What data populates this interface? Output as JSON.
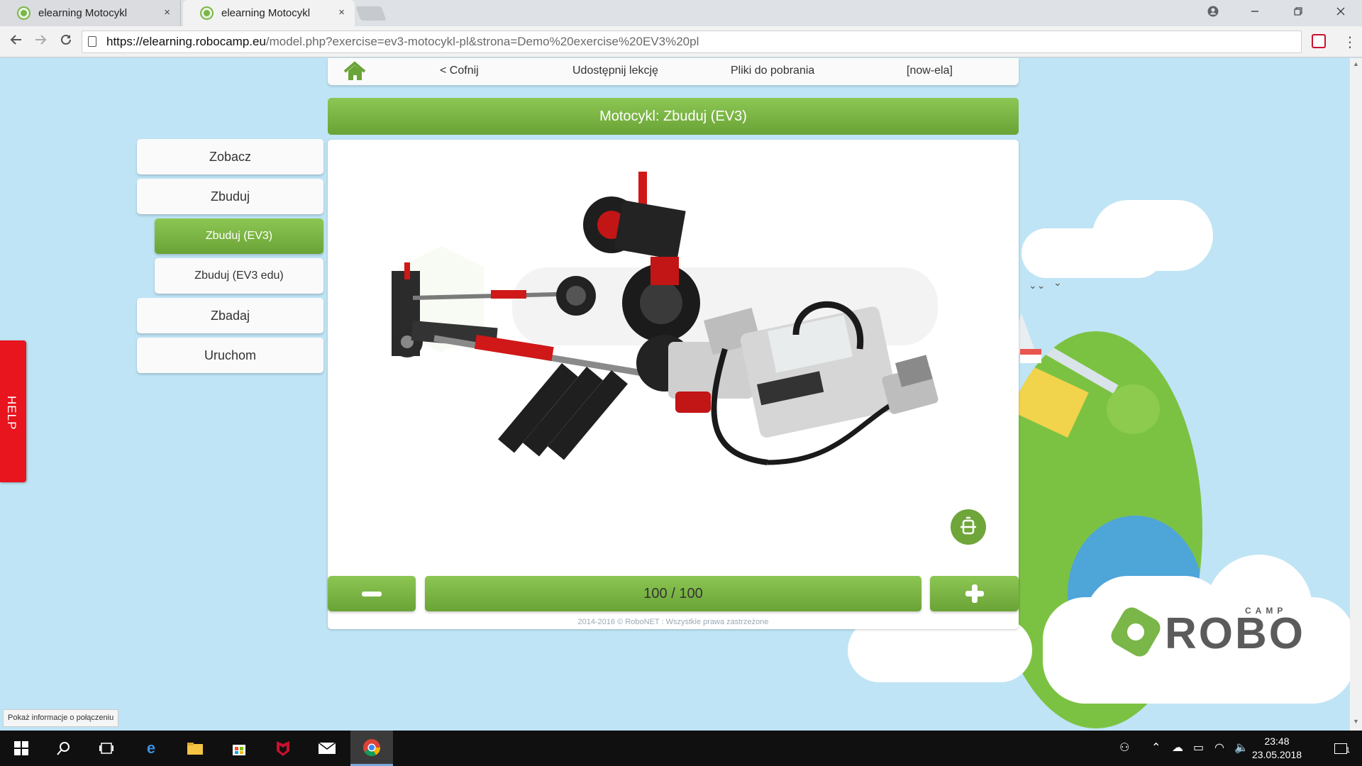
{
  "browser": {
    "tabs": [
      {
        "title": "elearning Motocykl",
        "close": "×"
      },
      {
        "title": "elearning Motocykl",
        "close": "×"
      }
    ],
    "url_host": "https://elearning.robocamp.eu",
    "url_rest": "/model.php?exercise=ev3-motocykl-pl&strona=Demo%20exercise%20EV3%20pl"
  },
  "nav": {
    "back": "< Cofnij",
    "share": "Udostępnij lekcję",
    "downloads": "Pliki do pobrania",
    "user": "[now-ela]"
  },
  "page_title": "Motocykl: Zbuduj (EV3)",
  "sidebar": {
    "items": [
      {
        "label": "Zobacz"
      },
      {
        "label": "Zbuduj"
      },
      {
        "label": "Zbuduj (EV3)"
      },
      {
        "label": "Zbuduj (EV3 edu)"
      },
      {
        "label": "Zbadaj"
      },
      {
        "label": "Uruchom"
      }
    ]
  },
  "help_label": "HELP",
  "step": {
    "counter": "100 / 100"
  },
  "copyright": "2014-2016 © RoboNET : Wszystkie prawa zastrzeżone",
  "logo": {
    "text": "ROBO",
    "camp": "CAMP"
  },
  "status_tip": "Pokaż informacje o połączeniu",
  "clock": {
    "time": "23:48",
    "date": "23.05.2018"
  },
  "notifications_count": "1",
  "colors": {
    "accent_green": "#7ab648",
    "help_red": "#e8141e"
  }
}
